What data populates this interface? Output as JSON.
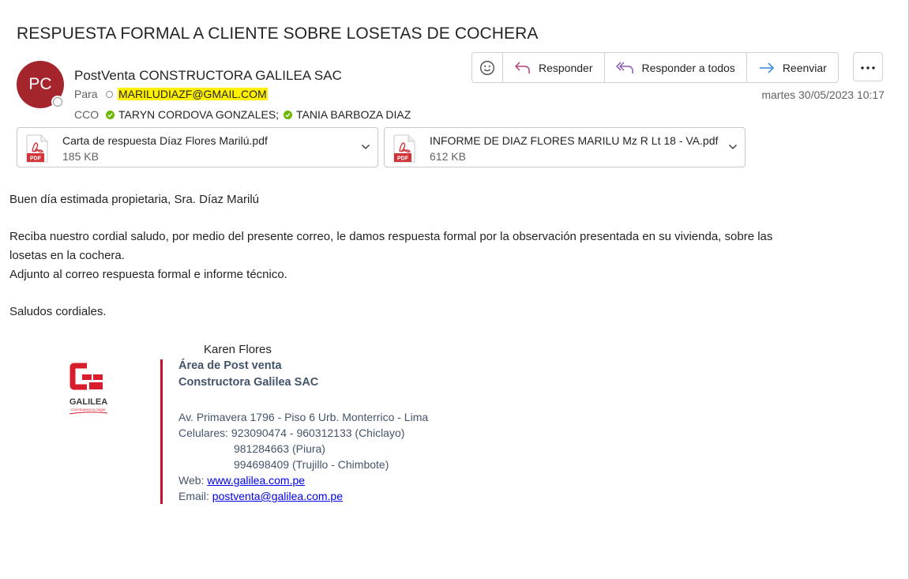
{
  "email": {
    "subject": "RESPUESTA FORMAL A CLIENTE SOBRE LOSETAS DE COCHERA",
    "sender": {
      "initials": "PC",
      "name": "PostVenta CONSTRUCTORA GALILEA SAC",
      "avatar_color": "#a4262c"
    },
    "to_label": "Para",
    "to": "MARILUDIAZF@GMAIL.COM",
    "cco_label": "CCO",
    "cco": [
      "TARYN CORDOVA GONZALES;",
      "TANIA BARBOZA DIAZ"
    ],
    "datetime": "martes 30/05/2023 10:17",
    "actions": {
      "emoji_icon": "smiley-icon",
      "reply": "Responder",
      "reply_all": "Responder a todos",
      "forward": "Reenviar",
      "more_icon": "more-icon"
    },
    "attachments": [
      {
        "name": "Carta de respuesta Díaz Flores Marilú.pdf",
        "size": "185 KB",
        "icon": "pdf-icon"
      },
      {
        "name": "INFORME DE DIAZ FLORES MARILU  Mz R Lt 18 - VA.pdf",
        "size": "612 KB",
        "icon": "pdf-icon"
      }
    ],
    "body": {
      "greeting": "Buen día estimada propietaria, Sra. Díaz Marilú",
      "p1_line1": "Reciba nuestro cordial saludo, por medio del presente correo, le damos respuesta formal por la observación presentada en su vivienda, sobre las",
      "p1_line2": "losetas en la cochera.",
      "p2": "Adjunto al correo respuesta formal e informe técnico.",
      "closing": "Saludos cordiales."
    },
    "signature": {
      "logo_text": "GALILEA",
      "logo_tagline": "Construimos tu hogar",
      "name": "Karen Flores",
      "department": "Área de Post venta",
      "company": "Constructora Galilea SAC",
      "address": "Av. Primavera 1796 - Piso 6 Urb. Monterrico - Lima",
      "phones_label": "Celulares:",
      "phone1": "923090474 - 960312133 (Chiclayo)",
      "phone2": "981284663 (Piura)",
      "phone3": "994698409 (Trujillo - Chimbote)",
      "web_label": "Web:",
      "web": "www.galilea.com.pe",
      "email_label": "Email:",
      "email": "postventa@galilea.com.pe",
      "accent_color": "#c8102e"
    }
  }
}
